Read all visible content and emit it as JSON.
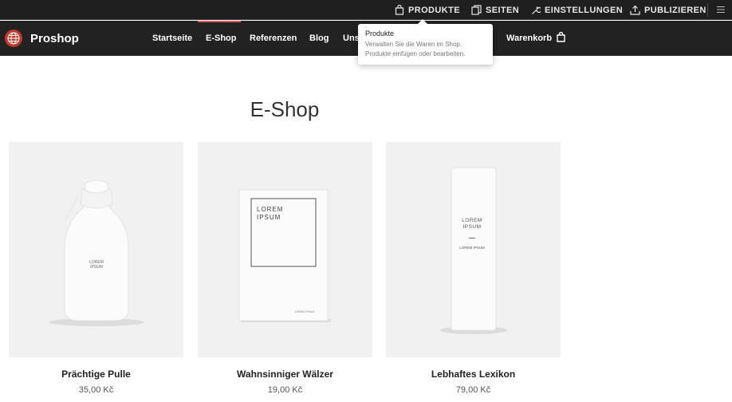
{
  "editor": {
    "items": [
      {
        "label": "PRODUKTE",
        "icon": "bag-icon"
      },
      {
        "label": "SEITEN",
        "icon": "pages-icon"
      },
      {
        "label": "EINSTELLUNGEN",
        "icon": "wrench-icon"
      },
      {
        "label": "PUBLIZIEREN",
        "icon": "upload-icon"
      }
    ],
    "menu_icon": "hamburger-icon"
  },
  "site": {
    "brand": "Proshop",
    "nav": [
      "Startseite",
      "E-Shop",
      "Referenzen",
      "Blog",
      "Uns"
    ],
    "active_nav": "E-Shop",
    "cart_label": "Warenkorb",
    "accent": "#e05555"
  },
  "tooltip": {
    "title": "Produkte",
    "text_line1": "Verwalten Sie die Waren im Shop.",
    "text_line2": "Produkte einfügen oder bearbeiten."
  },
  "page": {
    "title": "E-Shop",
    "products": [
      {
        "name": "Prächtige Pulle",
        "price": "35,00 Kč",
        "img_text": "LOREM IPSUM"
      },
      {
        "name": "Wahnsinniger Wälzer",
        "price": "19,00 Kč",
        "img_text": "LOREM IPSUM",
        "img_sub": "LOREM IPSUM"
      },
      {
        "name": "Lebhaftes Lexikon",
        "price": "79,00 Kč",
        "img_text": "LOREM IPSUM",
        "img_sub": "LOREM IPSUM"
      }
    ]
  }
}
